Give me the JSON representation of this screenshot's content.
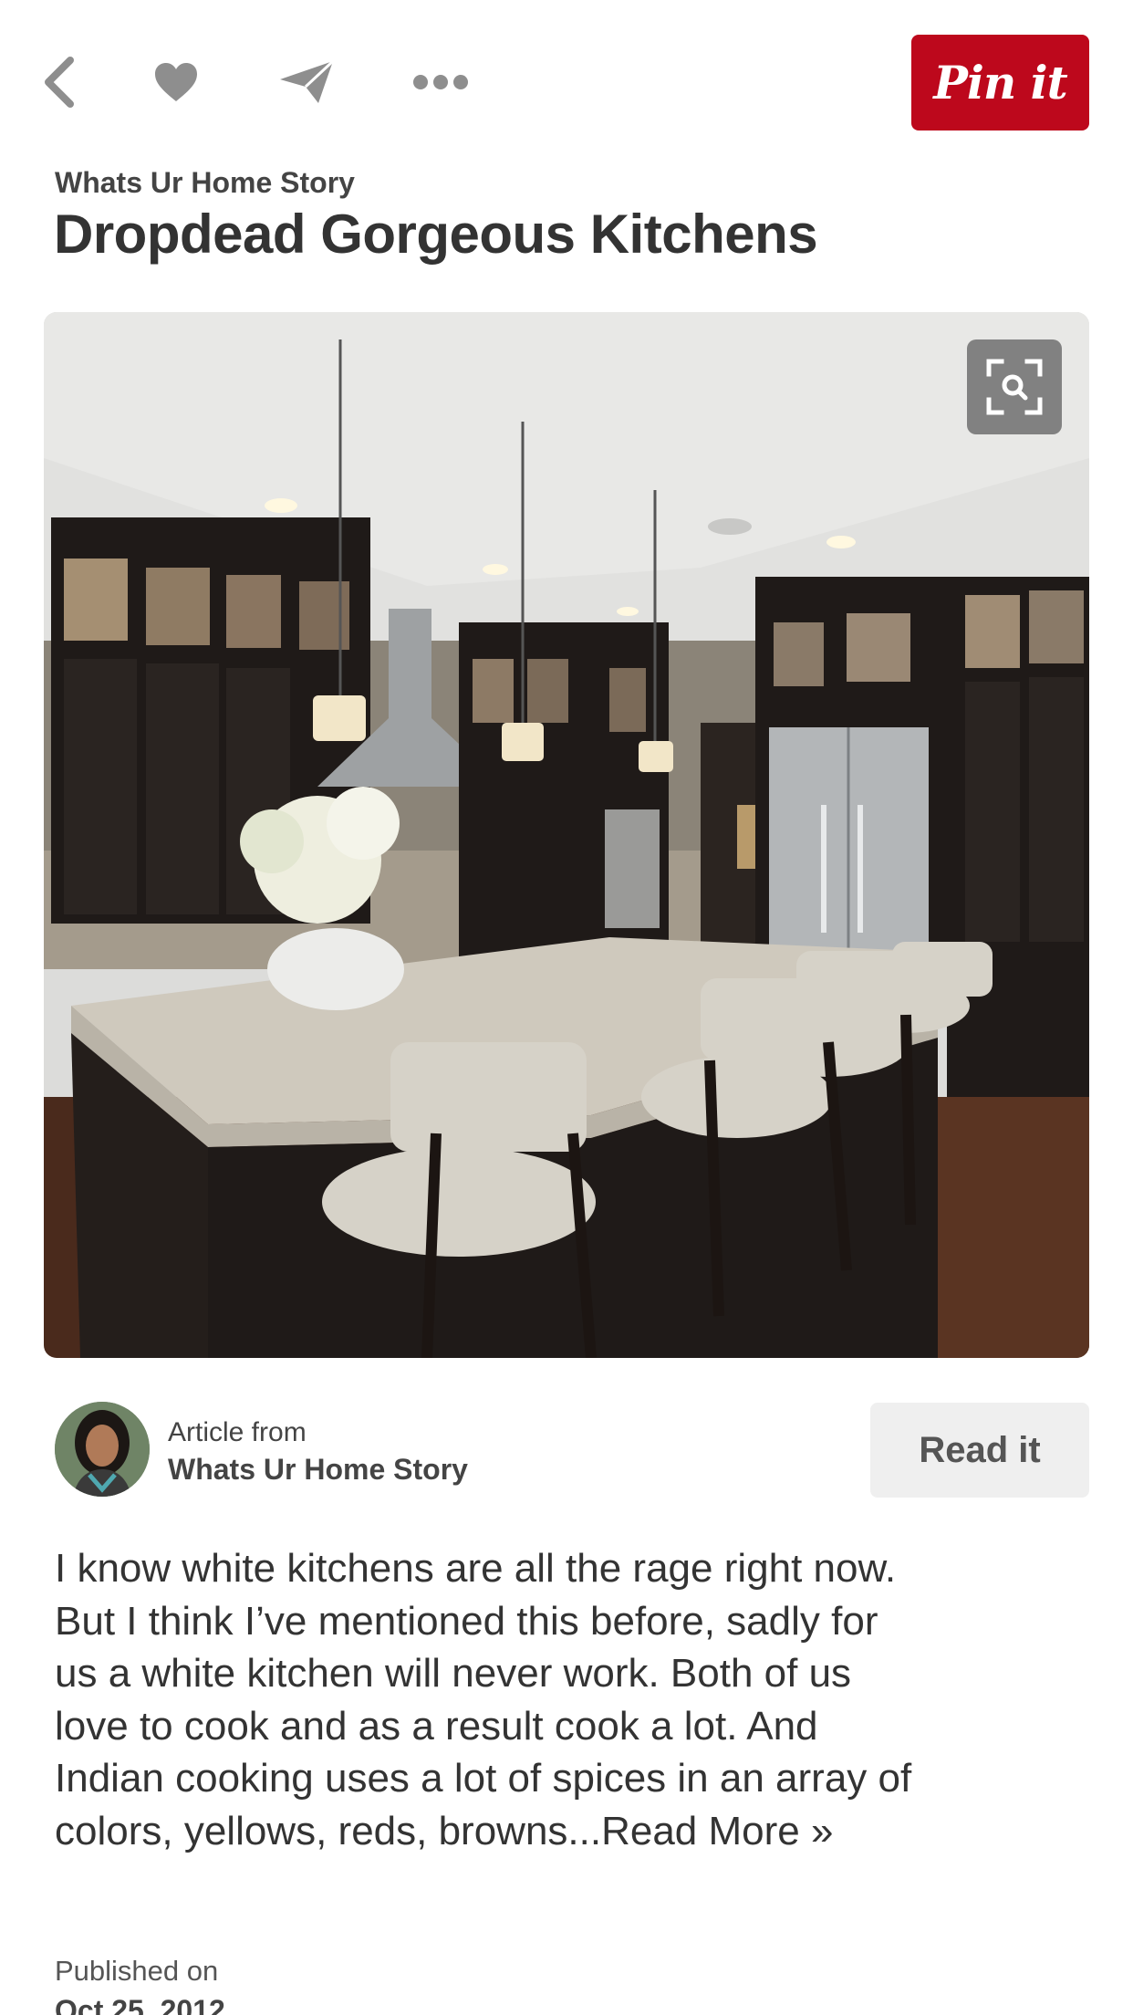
{
  "toolbar": {
    "back_icon": "chevron-left-icon",
    "like_icon": "heart-icon",
    "send_icon": "paper-plane-icon",
    "more_icon": "ellipsis-icon",
    "pin_label": "Pin it",
    "pin_color": "#bd081c"
  },
  "header": {
    "source": "Whats Ur Home Story",
    "title": "Dropdead Gorgeous Kitchens"
  },
  "image": {
    "description": "Dark cabinet kitchen with marble island, cream bar stools and pendant lights",
    "zoom_icon": "visual-search-icon"
  },
  "article": {
    "label": "Article from",
    "source": "Whats Ur Home Story",
    "read_label": "Read it"
  },
  "description": {
    "text": "I know white kitchens are all the rage right now. But I think I’ve mentioned this before, sadly for us a white kitchen will never work. Both of us love to cook and as a result cook a lot. And Indian cooking uses a lot of spices in an array of colors, yellows, reds, browns...",
    "read_more": "Read More »"
  },
  "published": {
    "label": "Published on",
    "date": "Oct 25, 2012"
  }
}
